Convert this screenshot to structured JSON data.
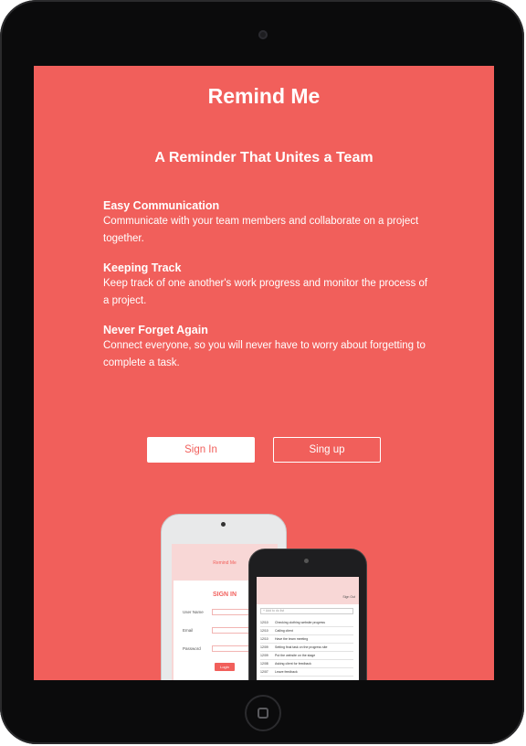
{
  "app": {
    "title": "Remind Me"
  },
  "hero": {
    "headline": "A Reminder That Unites a Team"
  },
  "features": [
    {
      "title": "Easy Communication",
      "text": "Communicate with your team members and collaborate on a project together."
    },
    {
      "title": "Keeping Track",
      "text": "Keep track of one another's work progress and monitor the process of a project."
    },
    {
      "title": "Never Forget Again",
      "text": "Connect everyone, so you will never have to worry about forgetting to complete a task."
    }
  ],
  "buttons": {
    "signin": "Sign In",
    "signup": "Sing up"
  },
  "mockup_phone_1": {
    "title": "Remind Me",
    "heading": "SIGN IN",
    "labels": [
      "User Name",
      "Email",
      "Password"
    ],
    "login": "Login"
  },
  "mockup_phone_2": {
    "signout": "Sign Out",
    "search_placeholder": "+ Add to do list",
    "rows": [
      {
        "date": "12/10",
        "task": "Checking clothing website progress"
      },
      {
        "date": "12/10",
        "task": "Calling client"
      },
      {
        "date": "12/10",
        "task": "Have the team meeting"
      },
      {
        "date": "12/09",
        "task": "Setting final task on the progress site"
      },
      {
        "date": "12/09",
        "task": "Put the website on the stage"
      },
      {
        "date": "12/08",
        "task": "Asking client for feedback"
      },
      {
        "date": "12/07",
        "task": "Leave feedback"
      }
    ]
  },
  "colors": {
    "primary": "#f15f5b",
    "bezel": "#0b0b0c"
  }
}
